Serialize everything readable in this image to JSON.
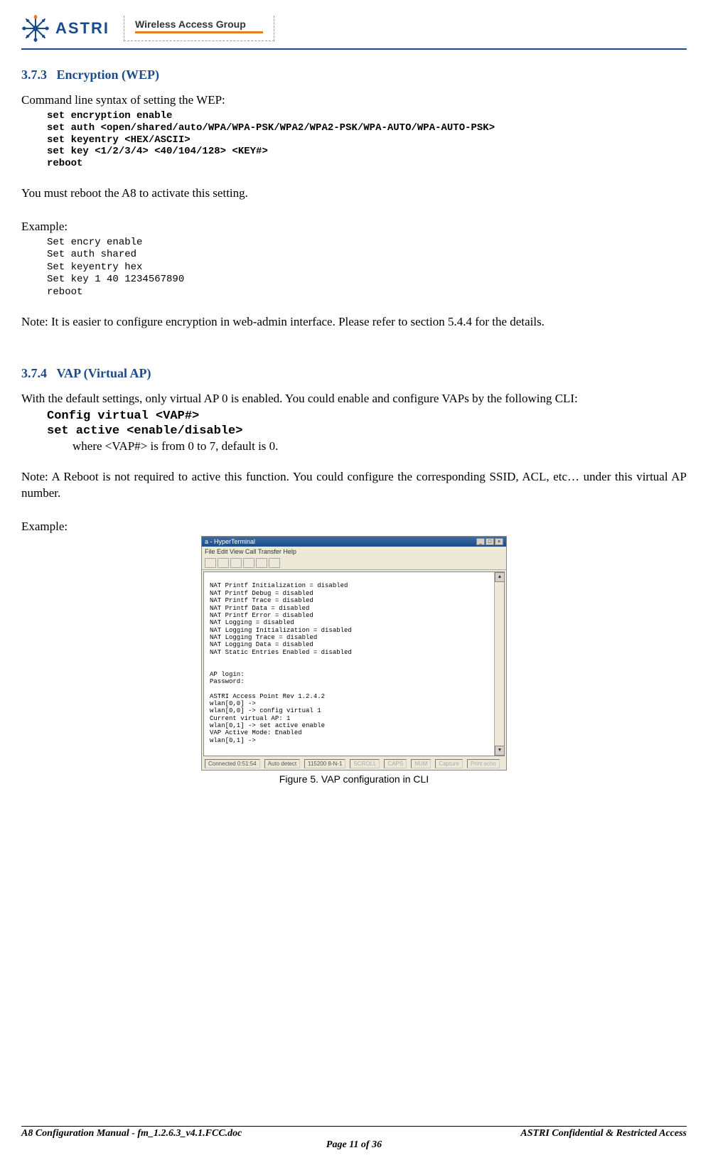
{
  "header": {
    "logo_text": "ASTRI",
    "group_label": "Wireless Access Group"
  },
  "section1": {
    "number": "3.7.3",
    "title": "Encryption (WEP)",
    "intro": "Command line syntax of setting the WEP:",
    "code": "set encryption enable\nset auth <open/shared/auto/WPA/WPA-PSK/WPA2/WPA2-PSK/WPA-AUTO/WPA-AUTO-PSK>\nset keyentry <HEX/ASCII>\nset key <1/2/3/4> <40/104/128> <KEY#>\nreboot",
    "reboot_note": "You must reboot the A8 to activate this setting.",
    "example_label": "Example:",
    "example_code": "Set encry enable\nSet auth shared\nSet keyentry hex\nSet key 1 40 1234567890\nreboot",
    "note": "Note: It is easier to configure encryption in web-admin interface. Please refer to section 5.4.4 for the details."
  },
  "section2": {
    "number": "3.7.4",
    "title": "VAP (Virtual AP)",
    "intro": "With the default settings, only virtual AP 0 is enabled. You could enable and configure VAPs by the following CLI:",
    "code": "Config virtual <VAP#>\nset active <enable/disable>",
    "where": "where <VAP#> is from 0 to 7, default is 0.",
    "note": "Note: A Reboot is not required to active this function. You could configure the corresponding SSID, ACL, etc… under this virtual AP number.",
    "example_label": "Example:"
  },
  "terminal": {
    "title": "a - HyperTerminal",
    "menu": "File  Edit  View  Call  Transfer  Help",
    "content": "NAT Printf Initialization = disabled\nNAT Printf Debug = disabled\nNAT Printf Trace = disabled\nNAT Printf Data = disabled\nNAT Printf Error = disabled\nNAT Logging = disabled\nNAT Logging Initialization = disabled\nNAT Logging Trace = disabled\nNAT Logging Data = disabled\nNAT Static Entries Enabled = disabled\n\n\nAP login:\nPassword:\n\nASTRI Access Point Rev 1.2.4.2\nwlan[0,0] ->\nwlan[0,0] -> config virtual 1\nCurrent virtual AP: 1\nwlan[0,1] -> set active enable\nVAP Active Mode: Enabled\nwlan[0,1] ->",
    "status": {
      "connected": "Connected 0:51:54",
      "autodetect": "Auto detect",
      "baud": "115200 8-N-1",
      "scroll": "SCROLL",
      "caps": "CAPS",
      "num": "NUM",
      "capture": "Capture",
      "printecho": "Print echo"
    }
  },
  "figure_caption": "Figure 5. VAP configuration in CLI",
  "footer": {
    "left": "A8 Configuration Manual - fm_1.2.6.3_v4.1.FCC.doc",
    "right": "ASTRI Confidential & Restricted Access",
    "center": "Page 11 of 36"
  }
}
